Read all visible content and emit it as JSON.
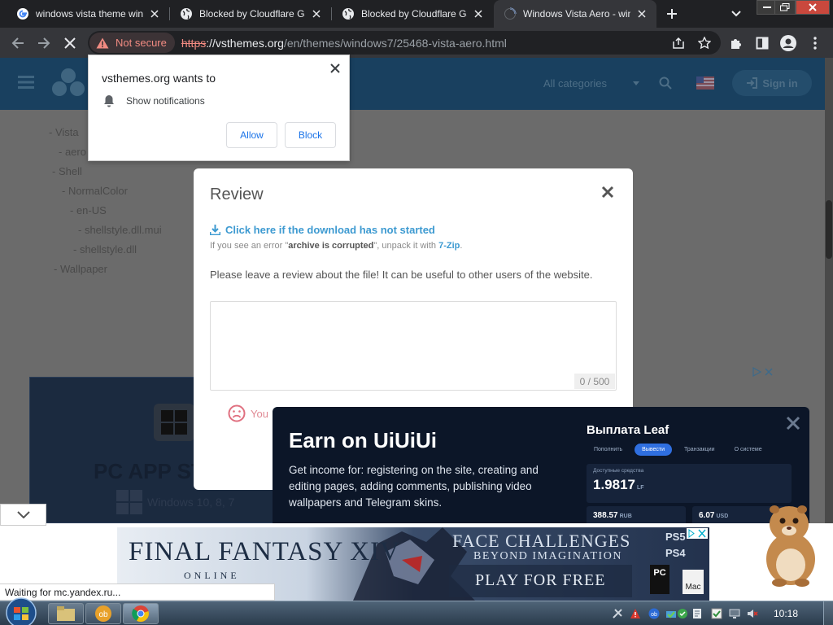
{
  "browser": {
    "tabs": [
      {
        "title": "windows vista theme win",
        "favicon": "google-icon",
        "active": false
      },
      {
        "title": "Blocked by Cloudflare Ga",
        "favicon": "globe-icon",
        "active": false
      },
      {
        "title": "Blocked by Cloudflare Ga",
        "favicon": "globe-icon",
        "active": false
      },
      {
        "title": "Windows Vista Aero - win",
        "favicon": "loading-spinner-icon",
        "active": true
      }
    ],
    "security_chip": "Not secure",
    "url": {
      "scheme": "https",
      "host": "://vsthemes.org",
      "path": "/en/themes/windows7/25468-vista-aero.html"
    }
  },
  "site": {
    "header_category": "All categories",
    "header_signin": "Sign in",
    "tree": [
      "- Vista",
      "- aero",
      "- Shell",
      "- NormalColor",
      "- en-US",
      "- shellstyle.dll.mui",
      "- shellstyle.dll",
      "- Wallpaper"
    ],
    "ad": {
      "title": "PC APP ST",
      "subtitle": "Windows 10, 8, 7"
    }
  },
  "permission_popup": {
    "title": "vsthemes.org wants to",
    "permission": "Show notifications",
    "allow_label": "Allow",
    "block_label": "Block"
  },
  "review_modal": {
    "title": "Review",
    "download_link": "Click here if the download has not started",
    "hint_prefix": "If you see an error \"",
    "hint_bold": "archive is corrupted",
    "hint_mid": "\", unpack it with ",
    "hint_tool": "7-Zip",
    "hint_suffix": ".",
    "prompt": "Please leave a review about the file! It can be useful to other users of the website.",
    "counter": "0 / 500",
    "rating_label": "You"
  },
  "earn_overlay": {
    "title": "Earn on UiUiUi",
    "description": "Get income for: registering on the site, creating and editing pages, adding comments, publishing video wallpapers and Telegram skins.",
    "panel_title": "Выплата Leaf",
    "panel_tabs": [
      "Пополнить",
      "Вывести",
      "Транзакции",
      "О системе"
    ],
    "balance_label": "Доступные средства",
    "balance_value": "1.9817",
    "balance_unit": "LF",
    "rub_value": "388.57",
    "rub_unit": "RUB",
    "usd_value": "6.07",
    "usd_unit": "USD"
  },
  "banner": {
    "game_title": "FINAL FANTASY XIV",
    "game_subtitle": "ONLINE",
    "tagline1": "FACE CHALLENGES",
    "tagline2": "BEYOND IMAGINATION",
    "cta": "PLAY FOR FREE",
    "platforms": [
      "PS5",
      "PS4"
    ],
    "pc_label": "PC",
    "mac_label": "Mac"
  },
  "status_text": "Waiting for mc.yandex.ru...",
  "taskbar": {
    "clock": "10:18"
  },
  "colors": {
    "link": "#3d9ad1",
    "not_secure": "#f28b82",
    "header": "#19405f",
    "accent_blue": "#2f6fe0"
  }
}
